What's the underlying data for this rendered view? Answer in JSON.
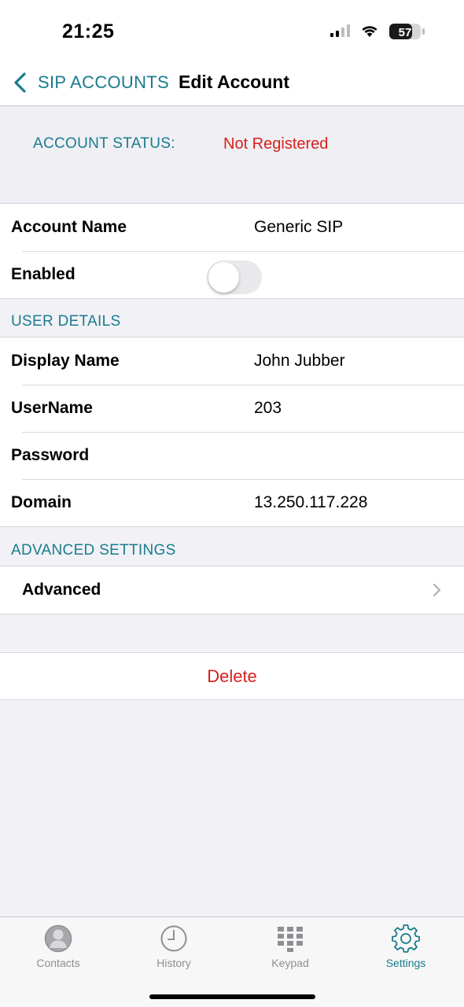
{
  "status_bar": {
    "time": "21:25",
    "battery": "57"
  },
  "nav": {
    "back_label": "SIP ACCOUNTS",
    "title": "Edit Account"
  },
  "account_status": {
    "label": "ACCOUNT STATUS:",
    "value": "Not Registered",
    "value_color": "#d7201c"
  },
  "account": {
    "name_label": "Account Name",
    "name_value": "Generic SIP",
    "enabled_label": "Enabled",
    "enabled": false
  },
  "user_details": {
    "header": "USER DETAILS",
    "rows": [
      {
        "label": "Display Name",
        "value": "John Jubber"
      },
      {
        "label": "UserName",
        "value": "203"
      },
      {
        "label": "Password",
        "value": ""
      },
      {
        "label": "Domain",
        "value": "13.250.117.228"
      }
    ]
  },
  "advanced": {
    "header": "ADVANCED SETTINGS",
    "row_label": "Advanced"
  },
  "delete_label": "Delete",
  "tabs": [
    {
      "label": "Contacts",
      "icon": "contacts-icon",
      "active": false
    },
    {
      "label": "History",
      "icon": "clock-icon",
      "active": false
    },
    {
      "label": "Keypad",
      "icon": "keypad-icon",
      "active": false
    },
    {
      "label": "Settings",
      "icon": "gear-icon",
      "active": true
    }
  ],
  "colors": {
    "accent": "#197c8e",
    "destructive": "#d7201c",
    "background": "#efeff4"
  }
}
